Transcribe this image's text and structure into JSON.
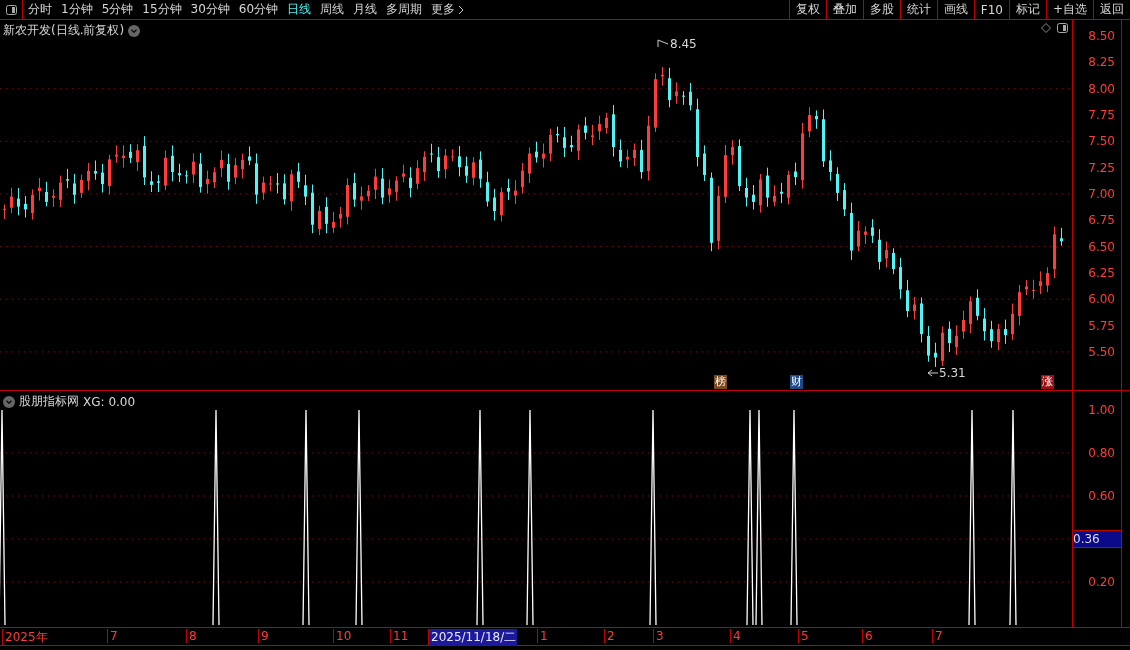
{
  "toolbar": {
    "periods": [
      {
        "label": "分时",
        "selected": false
      },
      {
        "label": "1分钟",
        "selected": false
      },
      {
        "label": "5分钟",
        "selected": false
      },
      {
        "label": "15分钟",
        "selected": false
      },
      {
        "label": "30分钟",
        "selected": false
      },
      {
        "label": "60分钟",
        "selected": false
      },
      {
        "label": "日线",
        "selected": true
      },
      {
        "label": "周线",
        "selected": false
      },
      {
        "label": "月线",
        "selected": false
      },
      {
        "label": "多周期",
        "selected": false
      },
      {
        "label": "更多",
        "selected": false
      }
    ],
    "actions": [
      "复权",
      "叠加",
      "多股",
      "统计",
      "画线",
      "F10",
      "标记",
      "+自选",
      "返回"
    ]
  },
  "main_chart": {
    "title": "新农开发(日线.前复权)",
    "y_ticks": [
      "8.50",
      "8.25",
      "8.00",
      "7.75",
      "7.50",
      "7.25",
      "7.00",
      "6.75",
      "6.50",
      "6.25",
      "6.00",
      "5.75",
      "5.50"
    ],
    "high_label": "8.45",
    "low_label": "5.31",
    "badges": [
      {
        "label": "榜",
        "color": "#7a4a1c"
      },
      {
        "label": "财",
        "color": "#1d4a86"
      },
      {
        "label": "涨",
        "color": "#9a1010"
      }
    ]
  },
  "indicator": {
    "title": "股朋指标网",
    "reading": "XG: 0.00",
    "y_ticks": [
      "1.00",
      "0.80",
      "0.60",
      "0.20"
    ],
    "cursor_value": "0.36"
  },
  "date_axis": {
    "labels": [
      {
        "label": "2025年",
        "selected": false
      },
      {
        "label": "7",
        "selected": false
      },
      {
        "label": "8",
        "selected": false
      },
      {
        "label": "9",
        "selected": false
      },
      {
        "label": "10",
        "selected": false
      },
      {
        "label": "11",
        "selected": false
      },
      {
        "label": "2025/11/18/二",
        "selected": true
      },
      {
        "label": "1",
        "selected": false
      },
      {
        "label": "2",
        "selected": false
      },
      {
        "label": "3",
        "selected": false
      },
      {
        "label": "4",
        "selected": false
      },
      {
        "label": "5",
        "selected": false
      },
      {
        "label": "6",
        "selected": false
      },
      {
        "label": "7",
        "selected": false
      }
    ]
  }
}
